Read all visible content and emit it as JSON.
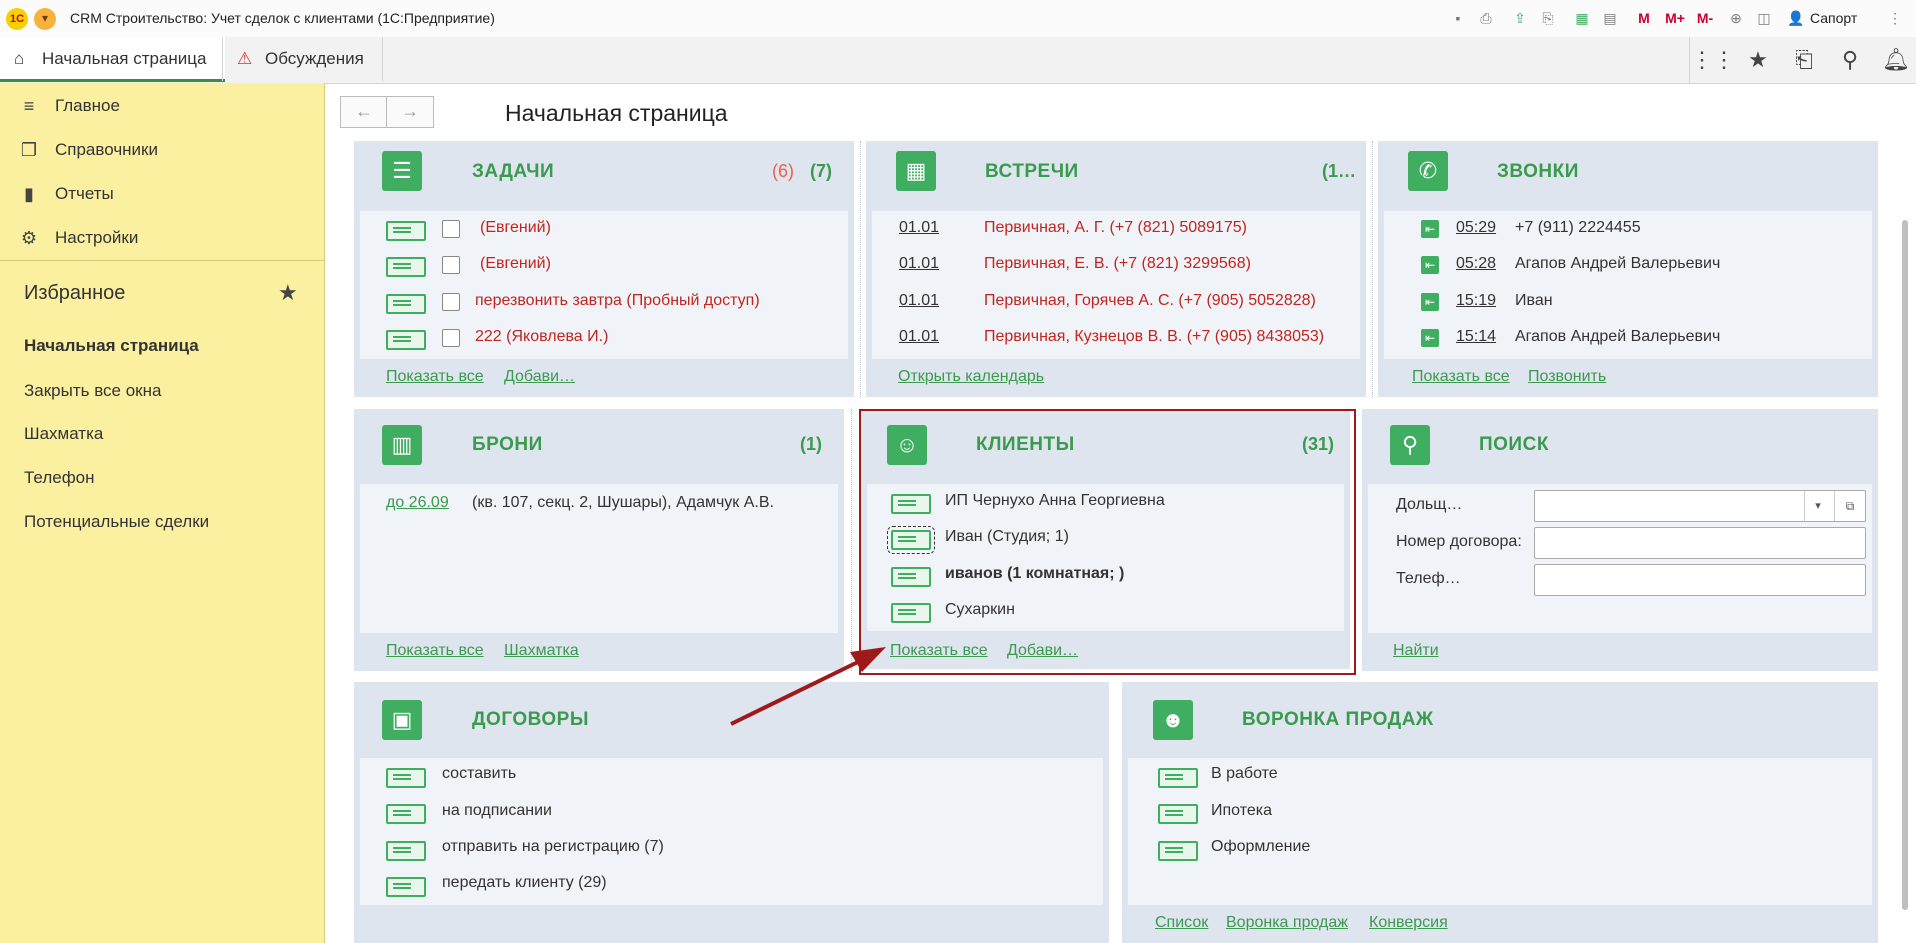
{
  "window": {
    "title": "CRM Строительство: Учет сделок с клиентами   (1С:Предприятие)",
    "logo": "1С",
    "user": "Сапорт",
    "toolbar_labels": [
      "M",
      "M+",
      "M-"
    ]
  },
  "tabs": [
    {
      "label": "Начальная страница",
      "icon": "home-icon",
      "active": true
    },
    {
      "label": "Обсуждения",
      "icon": "warning-icon",
      "active": false
    }
  ],
  "sidebar": {
    "sections": [
      {
        "label": "Главное",
        "icon": "menu-icon"
      },
      {
        "label": "Справочники",
        "icon": "copy-icon"
      },
      {
        "label": "Отчеты",
        "icon": "bar-chart-icon"
      },
      {
        "label": "Настройки",
        "icon": "gear-icon"
      }
    ],
    "favorites_title": "Избранное",
    "favorites": [
      {
        "label": "Начальная страница",
        "bold": true
      },
      {
        "label": "Закрыть все окна"
      },
      {
        "label": "Шахматка"
      },
      {
        "label": "Телефон"
      },
      {
        "label": "Потенциальные сделки"
      }
    ]
  },
  "page": {
    "title": "Начальная страница"
  },
  "panels": {
    "tasks": {
      "title": "ЗАДАЧИ",
      "count_red": "(6)",
      "count": "(7)",
      "items": [
        "(Евгений)",
        "(Евгений)",
        "перезвонить завтра (Пробный доступ)",
        "222 (Яковлева И.)"
      ],
      "links": [
        "Показать все",
        "Добави…"
      ]
    },
    "meetings": {
      "title": "ВСТРЕЧИ",
      "count": "(1…",
      "items": [
        {
          "date": "01.01",
          "text": "Первичная, А. Г. (+7 (821) 5089175)"
        },
        {
          "date": "01.01",
          "text": "Первичная, Е. В. (+7 (821) 3299568)"
        },
        {
          "date": "01.01",
          "text": "Первичная, Горячев А. С. (+7 (905) 5052828)"
        },
        {
          "date": "01.01",
          "text": "Первичная, Кузнецов В. В. (+7 (905) 8438053)"
        }
      ],
      "links": [
        "Открыть календарь"
      ]
    },
    "calls": {
      "title": "ЗВОНКИ",
      "items": [
        {
          "time": "05:29",
          "text": "+7 (911) 2224455"
        },
        {
          "time": "05:28",
          "text": "Агапов Андрей Валерьевич"
        },
        {
          "time": "15:19",
          "text": "Иван"
        },
        {
          "time": "15:14",
          "text": "Агапов Андрей Валерьевич"
        }
      ],
      "links": [
        "Показать все",
        "Позвонить"
      ]
    },
    "bookings": {
      "title": "БРОНИ",
      "count": "(1)",
      "items": [
        {
          "date": "до 26.09",
          "text": "(кв. 107, секц. 2, Шушары), Адамчук А.В."
        }
      ],
      "links": [
        "Показать все",
        "Шахматка"
      ]
    },
    "clients": {
      "title": "КЛИЕНТЫ",
      "count": "(31)",
      "items": [
        "ИП Чернухо Анна Георгиевна",
        "Иван (Студия; 1)",
        "иванов (1 комнатная; )",
        "Сухаркин"
      ],
      "links": [
        "Показать все",
        "Добави…"
      ]
    },
    "search": {
      "title": "ПОИСК",
      "fields": [
        "Дольщ…",
        "Номер договора:",
        "Телеф…"
      ],
      "links": [
        "Найти"
      ]
    },
    "contracts": {
      "title": "ДОГОВОРЫ",
      "items": [
        "составить",
        "на подписании",
        "отправить на регистрацию (7)",
        "передать клиенту (29)"
      ]
    },
    "funnel": {
      "title": "ВОРОНКА ПРОДАЖ",
      "items": [
        "В работе",
        "Ипотека",
        "Оформление"
      ],
      "links": [
        "Список",
        "Воронка продаж",
        "Конверсия"
      ]
    }
  },
  "colors": {
    "accent_green": "#3fae61",
    "link_green": "#3a9a4d",
    "sidebar_yellow": "#fbf0a0",
    "highlight_red": "#9e1a1a",
    "task_red": "#c0261f"
  }
}
